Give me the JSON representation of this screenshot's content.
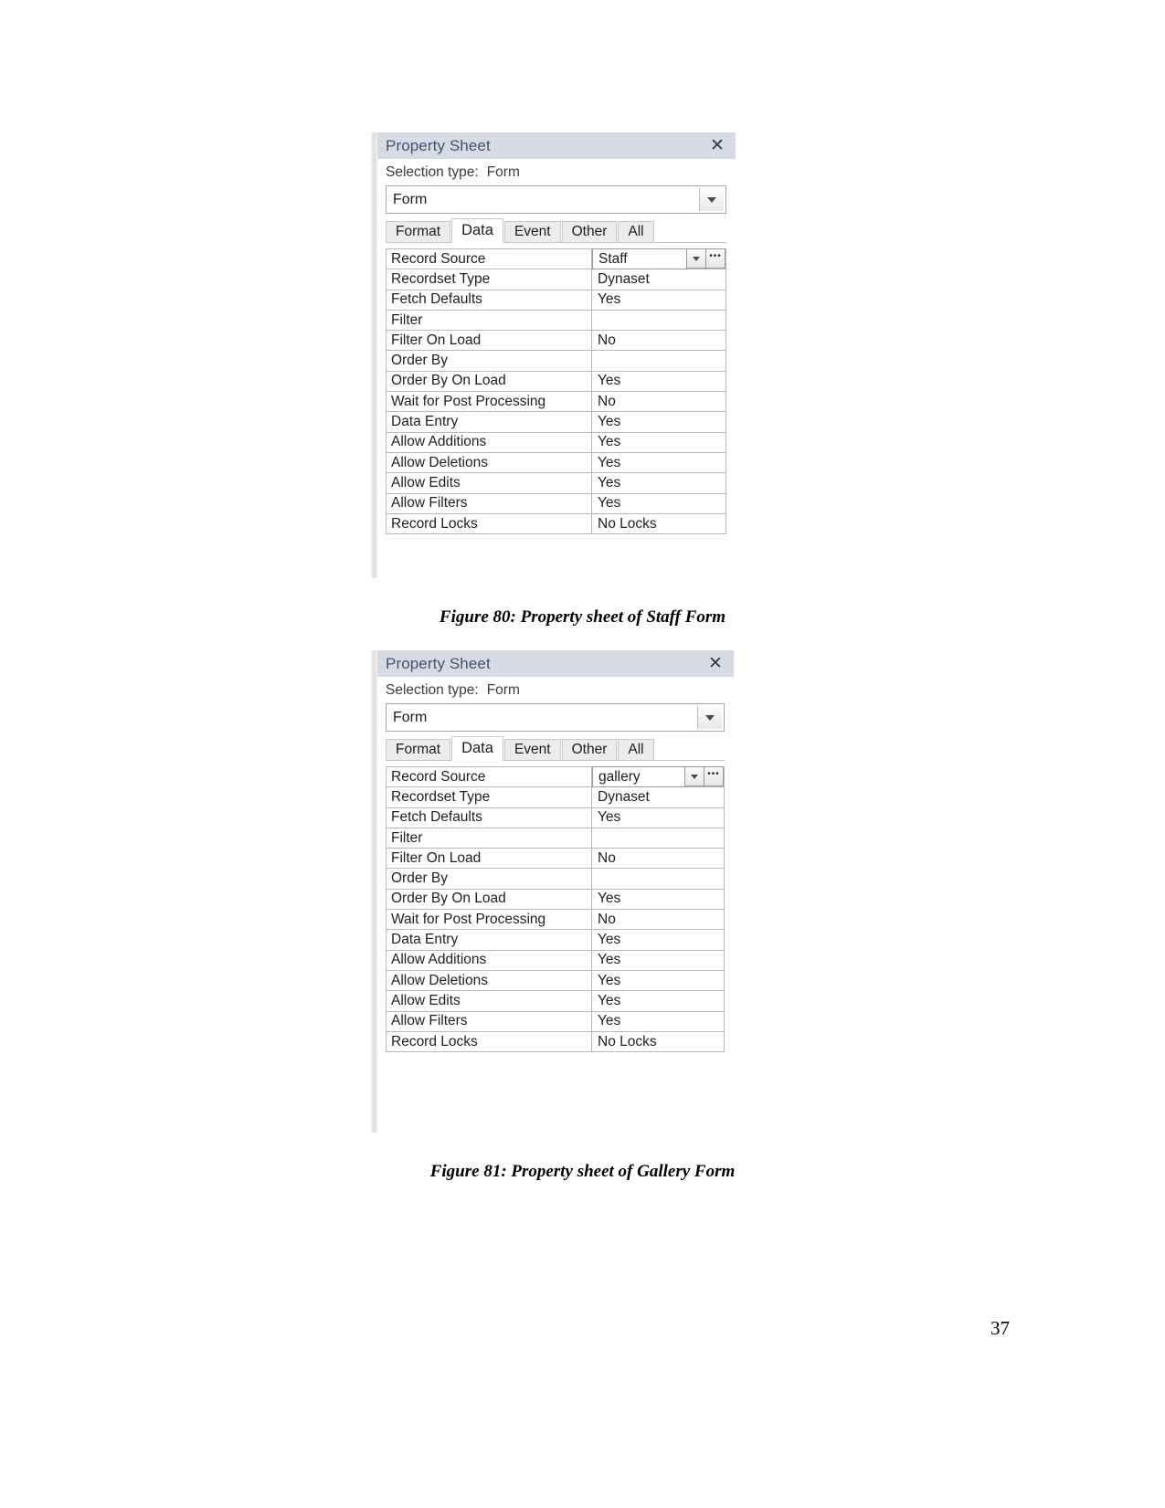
{
  "document": {
    "page_number": "37"
  },
  "figures": [
    {
      "caption": "Figure 80: Property sheet of Staff Form",
      "panel": {
        "title": "Property Sheet",
        "close_icon": "close-icon",
        "selection_type_label": "Selection type:",
        "selection_type_value": "Form",
        "object_combo_value": "Form",
        "object_combo_arrow_icon": "chevron-down-icon",
        "tabs": [
          {
            "label": "Format",
            "active": false
          },
          {
            "label": "Data",
            "active": true
          },
          {
            "label": "Event",
            "active": false
          },
          {
            "label": "Other",
            "active": false
          },
          {
            "label": "All",
            "active": false
          }
        ],
        "properties": [
          {
            "name": "Record Source",
            "value": "Staff",
            "editing": true
          },
          {
            "name": "Recordset Type",
            "value": "Dynaset",
            "editing": false
          },
          {
            "name": "Fetch Defaults",
            "value": "Yes",
            "editing": false
          },
          {
            "name": "Filter",
            "value": "",
            "editing": false
          },
          {
            "name": "Filter On Load",
            "value": "No",
            "editing": false
          },
          {
            "name": "Order By",
            "value": "",
            "editing": false
          },
          {
            "name": "Order By On Load",
            "value": "Yes",
            "editing": false
          },
          {
            "name": "Wait for Post Processing",
            "value": "No",
            "editing": false
          },
          {
            "name": "Data Entry",
            "value": "Yes",
            "editing": false
          },
          {
            "name": "Allow Additions",
            "value": "Yes",
            "editing": false
          },
          {
            "name": "Allow Deletions",
            "value": "Yes",
            "editing": false
          },
          {
            "name": "Allow Edits",
            "value": "Yes",
            "editing": false
          },
          {
            "name": "Allow Filters",
            "value": "Yes",
            "editing": false
          },
          {
            "name": "Record Locks",
            "value": "No Locks",
            "editing": false
          }
        ],
        "editor_dropdown_icon": "chevron-down-icon",
        "editor_builder_label": "•••"
      }
    },
    {
      "caption": "Figure 81: Property sheet of Gallery Form",
      "panel": {
        "title": "Property Sheet",
        "close_icon": "close-icon",
        "selection_type_label": "Selection type:",
        "selection_type_value": "Form",
        "object_combo_value": "Form",
        "object_combo_arrow_icon": "chevron-down-icon",
        "tabs": [
          {
            "label": "Format",
            "active": false
          },
          {
            "label": "Data",
            "active": true
          },
          {
            "label": "Event",
            "active": false
          },
          {
            "label": "Other",
            "active": false
          },
          {
            "label": "All",
            "active": false
          }
        ],
        "properties": [
          {
            "name": "Record Source",
            "value": "gallery",
            "editing": true
          },
          {
            "name": "Recordset Type",
            "value": "Dynaset",
            "editing": false
          },
          {
            "name": "Fetch Defaults",
            "value": "Yes",
            "editing": false
          },
          {
            "name": "Filter",
            "value": "",
            "editing": false
          },
          {
            "name": "Filter On Load",
            "value": "No",
            "editing": false
          },
          {
            "name": "Order By",
            "value": "",
            "editing": false
          },
          {
            "name": "Order By On Load",
            "value": "Yes",
            "editing": false
          },
          {
            "name": "Wait for Post Processing",
            "value": "No",
            "editing": false
          },
          {
            "name": "Data Entry",
            "value": "Yes",
            "editing": false
          },
          {
            "name": "Allow Additions",
            "value": "Yes",
            "editing": false
          },
          {
            "name": "Allow Deletions",
            "value": "Yes",
            "editing": false
          },
          {
            "name": "Allow Edits",
            "value": "Yes",
            "editing": false
          },
          {
            "name": "Allow Filters",
            "value": "Yes",
            "editing": false
          },
          {
            "name": "Record Locks",
            "value": "No Locks",
            "editing": false
          }
        ],
        "editor_dropdown_icon": "chevron-down-icon",
        "editor_builder_label": "•••"
      }
    }
  ],
  "colors": {
    "title_bar_bg": "#d6dbe3",
    "title_text": "#44546a",
    "grid_border": "#b9b9b9",
    "page_bg": "#ffffff"
  }
}
